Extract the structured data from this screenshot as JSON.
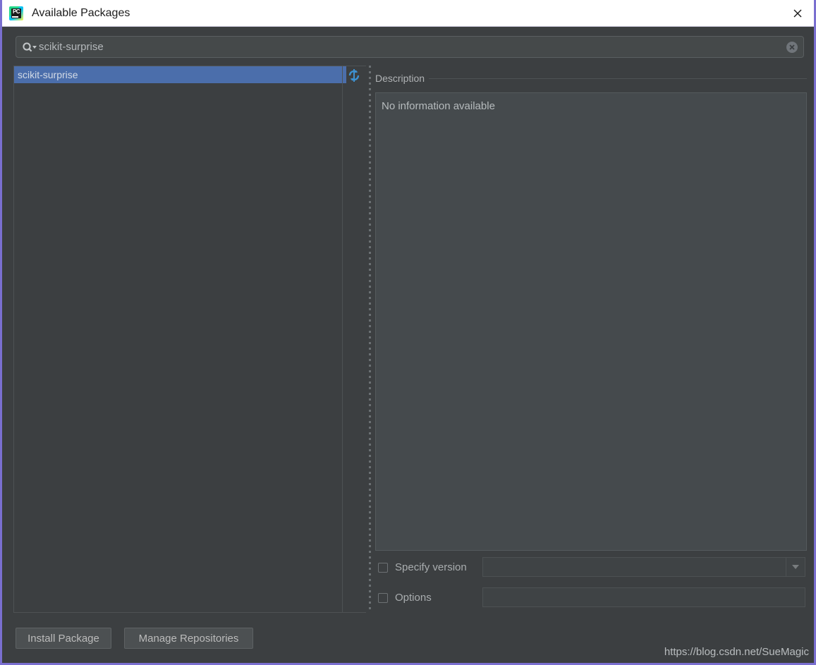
{
  "window": {
    "title": "Available Packages",
    "app_icon": "pycharm-icon",
    "close_icon": "close-icon",
    "border_color": "#7a6fd0",
    "titlebar_bg": "#ffffff",
    "dialog_bg": "#3c3f41"
  },
  "search": {
    "icon": "search-icon",
    "value": "scikit-surprise",
    "placeholder": "",
    "clear_icon": "clear-icon"
  },
  "package_list": {
    "refresh_icon": "refresh-icon",
    "selected_index": 0,
    "selection_color": "#4b6eab",
    "items": [
      {
        "label": "scikit-surprise",
        "selected": true
      }
    ]
  },
  "description": {
    "header": "Description",
    "body": "No information available"
  },
  "options": {
    "specify_version": {
      "label": "Specify version",
      "checked": false,
      "value": "",
      "enabled": false,
      "dropdown_icon": "chevron-down-icon"
    },
    "options_flag": {
      "label": "Options",
      "checked": false,
      "value": "",
      "enabled": false
    }
  },
  "buttons": {
    "install": "Install Package",
    "manage": "Manage Repositories"
  },
  "watermark": "https://blog.csdn.net/SueMagic"
}
